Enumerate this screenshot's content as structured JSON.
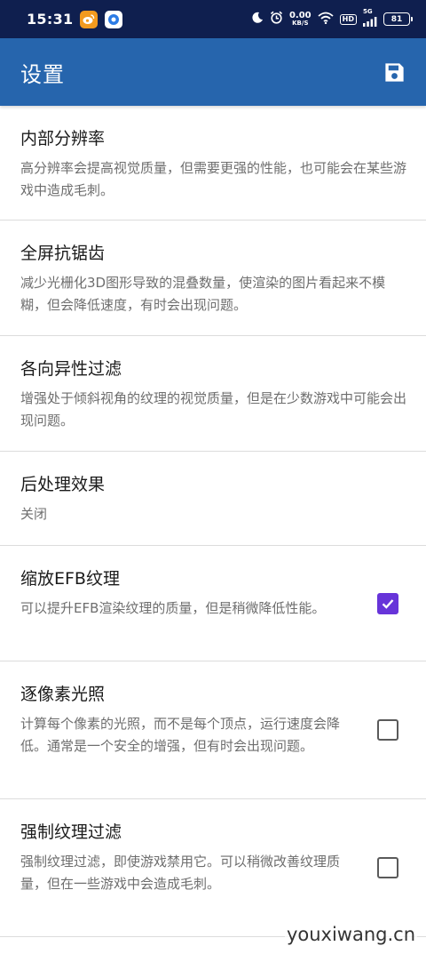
{
  "status_bar": {
    "time": "15:31",
    "net_speed": "0.00",
    "net_speed_unit": "KB/S",
    "hd_label": "HD",
    "network_type": "5G",
    "battery": "81"
  },
  "app_bar": {
    "title": "设置",
    "save_icon": "save-icon"
  },
  "settings": [
    {
      "title": "内部分辨率",
      "description": "高分辨率会提高视觉质量，但需要更强的性能，也可能会在某些游戏中造成毛刺。"
    },
    {
      "title": "全屏抗锯齿",
      "description": "减少光栅化3D图形导致的混叠数量，使渲染的图片看起来不模糊，但会降低速度，有时会出现问题。"
    },
    {
      "title": "各向异性过滤",
      "description": "增强处于倾斜视角的纹理的视觉质量，但是在少数游戏中可能会出现问题。"
    },
    {
      "title": "后处理效果",
      "description": "关闭"
    },
    {
      "title": "缩放EFB纹理",
      "description": "可以提升EFB渲染纹理的质量，但是稍微降低性能。",
      "checked": true
    },
    {
      "title": "逐像素光照",
      "description": "计算每个像素的光照，而不是每个顶点，运行速度会降低。通常是一个安全的增强，但有时会出现问题。",
      "checked": false
    },
    {
      "title": "强制纹理过滤",
      "description": "强制纹理过滤，即使游戏禁用它。可以稍微改善纹理质量，但在一些游戏中会造成毛刺。",
      "checked": false
    }
  ],
  "watermark": "youxiwang.cn",
  "colors": {
    "status_bar": "#0f1f4f",
    "app_bar": "#2665ad",
    "checkbox_checked": "#6734d9"
  }
}
